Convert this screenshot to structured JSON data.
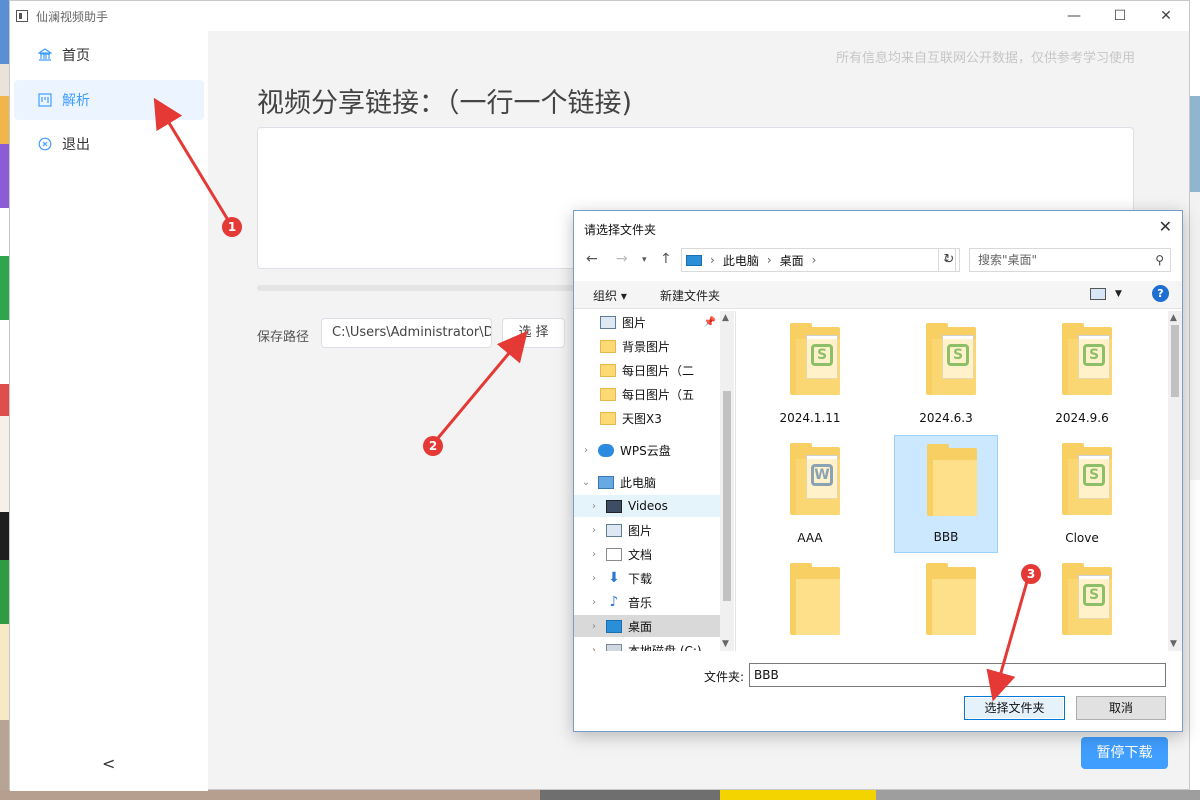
{
  "window": {
    "title": "仙澜视频助手",
    "controls": [
      "—",
      "☐",
      "✕"
    ]
  },
  "sidebar": {
    "items": [
      {
        "label": "首页",
        "icon": "bank-icon"
      },
      {
        "label": "解析",
        "icon": "board-icon"
      },
      {
        "label": "退出",
        "icon": "close-circle-icon"
      }
    ],
    "collapse": "<"
  },
  "main": {
    "notice": "所有信息均来自互联网公开数据，仅供参考学习使用",
    "heading": "视频分享链接：（一行一个链接)",
    "link_input_value": "",
    "progress": 0,
    "save_label": "保存路径",
    "save_path": "C:\\Users\\Administrator\\De",
    "choose_button": "选择",
    "pause_button": "暂停下载"
  },
  "dialog": {
    "title": "请选择文件夹",
    "close": "✕",
    "address": {
      "root": "此电脑",
      "current": "桌面"
    },
    "search_placeholder": "搜索\"桌面\"",
    "toolbar": {
      "organize": "组织 ▾",
      "new_folder": "新建文件夹"
    },
    "nav_tree": [
      {
        "label": "图片",
        "icon": "ico-pic",
        "pinned": true
      },
      {
        "label": "背景图片",
        "icon": "ico-folder"
      },
      {
        "label": "每日图片（二",
        "icon": "ico-folder"
      },
      {
        "label": "每日图片（五",
        "icon": "ico-folder"
      },
      {
        "label": "天图X3",
        "icon": "ico-folder"
      },
      {
        "label": "WPS云盘",
        "icon": "ico-cloud"
      },
      {
        "label": "此电脑",
        "icon": "ico-pc"
      },
      {
        "label": "Videos",
        "icon": "ico-video"
      },
      {
        "label": "图片",
        "icon": "ico-pic"
      },
      {
        "label": "文档",
        "icon": "ico-doc"
      },
      {
        "label": "下载",
        "icon": "ico-down"
      },
      {
        "label": "音乐",
        "icon": "ico-music"
      },
      {
        "label": "桌面",
        "icon": "ico-desk"
      },
      {
        "label": "本地磁盘 (C:)",
        "icon": "ico-disk"
      }
    ],
    "files": [
      {
        "label": "2024.1.11",
        "doc": "S"
      },
      {
        "label": "2024.6.3",
        "doc": "S"
      },
      {
        "label": "2024.9.6",
        "doc": "S"
      },
      {
        "label": "AAA",
        "doc": "W"
      },
      {
        "label": "BBB",
        "doc": ""
      },
      {
        "label": "Clove",
        "doc": "S"
      },
      {
        "label": "",
        "doc": ""
      },
      {
        "label": "",
        "doc": ""
      },
      {
        "label": "",
        "doc": "S"
      }
    ],
    "folder_label": "文件夹:",
    "folder_value": "BBB",
    "ok_button": "选择文件夹",
    "cancel_button": "取消"
  },
  "annotations": [
    "1",
    "2",
    "3"
  ],
  "colors": {
    "accent": "#409eff",
    "annotation": "#e53935"
  }
}
